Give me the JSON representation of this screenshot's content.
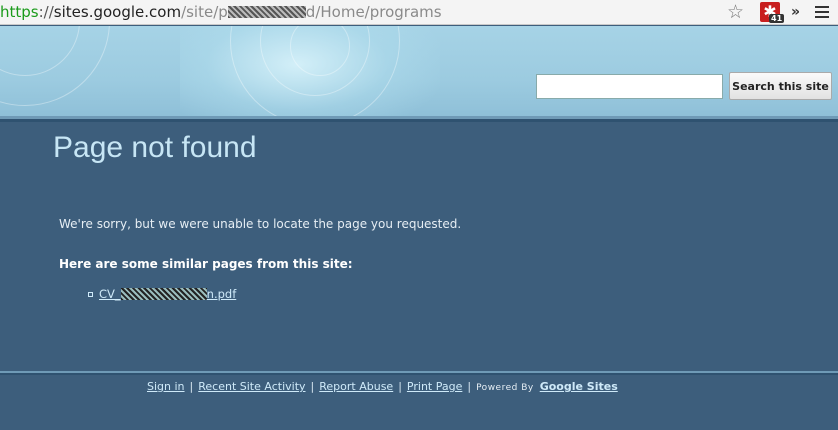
{
  "browser": {
    "url_scheme": "https",
    "url_host": "sites.google.com",
    "url_path_prefix": "/site/p",
    "url_path_suffix": "d/Home/programs",
    "extension_icon": "lastpass-asterisk-icon",
    "extension_badge": "41",
    "overflow_label": "»"
  },
  "header": {
    "search_input_value": "",
    "search_button_label": "Search this site"
  },
  "main": {
    "title": "Page not found",
    "sorry_text": "We're sorry, but we were unable to locate the page you requested.",
    "similar_heading": "Here are some similar pages from this site:",
    "results": [
      {
        "prefix": "CV_",
        "suffix": "n.pdf"
      }
    ]
  },
  "footer": {
    "links": [
      "Sign in",
      "Recent Site Activity",
      "Report Abuse",
      "Print Page"
    ],
    "powered_by": "Powered By",
    "brand_link": "Google Sites"
  },
  "colors": {
    "page_background": "#3d5e7c",
    "title": "#c7e6f5",
    "link": "#cfeaf9",
    "header_background": "#9ccbe0"
  }
}
